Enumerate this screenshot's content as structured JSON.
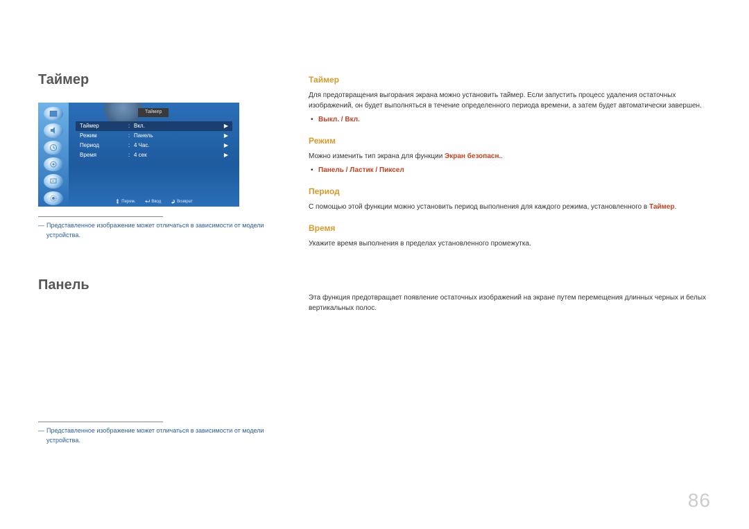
{
  "page_number": "86",
  "left": {
    "title1": "Таймер",
    "title2": "Панель",
    "caption": "Представленное изображение может отличаться в зависимости от модели устройства."
  },
  "osd": {
    "crumb": "Таймер",
    "rows": [
      {
        "label": "Таймер",
        "value": "Вкл.",
        "active": true
      },
      {
        "label": "Режим",
        "value": "Панель",
        "active": false
      },
      {
        "label": "Период",
        "value": "4 Час.",
        "active": false
      },
      {
        "label": "Время",
        "value": "4 сек",
        "active": false
      }
    ],
    "footer": {
      "move": "Перем.",
      "enter": "Ввод",
      "return": "Возврат"
    },
    "icons": [
      "picture-icon",
      "sound-icon",
      "clock-icon",
      "orbit-icon",
      "input-icon",
      "setup-icon"
    ]
  },
  "right": {
    "timer": {
      "heading": "Таймер",
      "desc": "Для предотвращения выгорания экрана можно установить таймер. Если запустить процесс удаления остаточных изображений, он будет выполняться в течение определенного периода времени, а затем будет автоматически завершен.",
      "options_prefix": "",
      "opt_off": "Выкл.",
      "opt_sep": " / ",
      "opt_on": "Вкл."
    },
    "mode": {
      "heading": "Режим",
      "desc_pre": "Можно изменить тип экрана для функции ",
      "desc_highlight": "Экран безопасн.",
      "desc_post": ".",
      "opt1": "Панель",
      "opt2": "Ластик",
      "opt3": "Пиксел",
      "sep": " / "
    },
    "period": {
      "heading": "Период",
      "desc_pre": "С помощью этой функции можно установить период выполнения для каждого режима, установленного в ",
      "desc_highlight": "Таймер",
      "desc_post": "."
    },
    "time": {
      "heading": "Время",
      "desc": "Укажите время выполнения в пределах установленного промежутка."
    },
    "panel": {
      "desc": "Эта функция предотвращает появление остаточных изображений на экране путем перемещения длинных черных и белых вертикальных полос."
    }
  }
}
